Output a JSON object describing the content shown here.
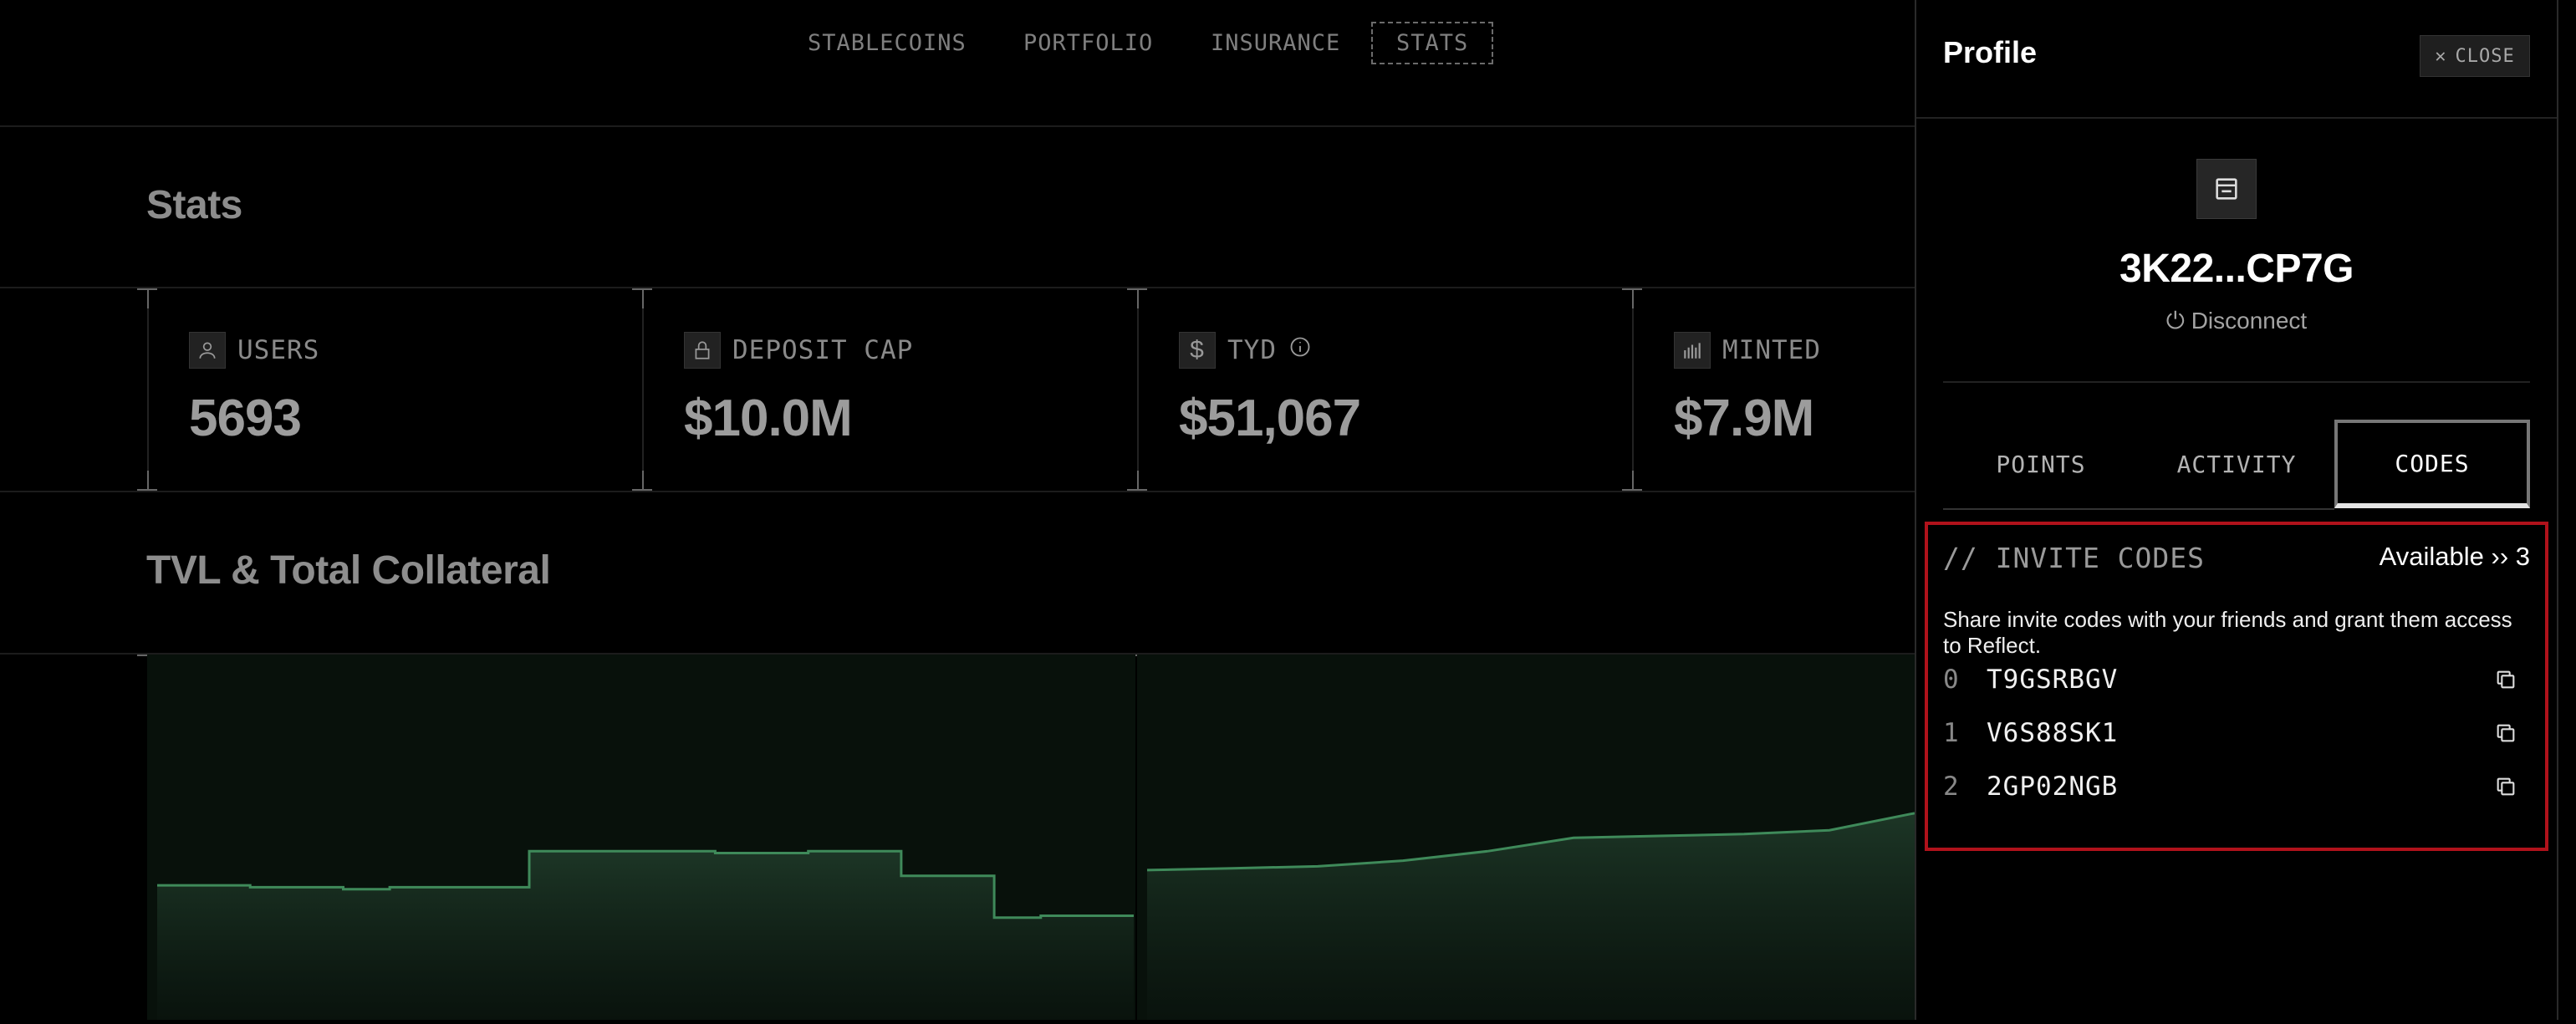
{
  "nav": {
    "items": [
      "STABLECOINS",
      "PORTFOLIO",
      "INSURANCE",
      "STATS"
    ],
    "active": "STATS"
  },
  "stats": {
    "title": "Stats",
    "cards": [
      {
        "label": "USERS",
        "value": "5693",
        "icon": "user-icon"
      },
      {
        "label": "DEPOSIT CAP",
        "value": "$10.0M",
        "icon": "lock-icon"
      },
      {
        "label": "TYD",
        "value": "$51,067",
        "icon": "dollar-icon"
      },
      {
        "label": "MINTED",
        "value": "$7.9M",
        "icon": "bars-icon"
      }
    ]
  },
  "chart_section": {
    "title": "TVL & Total Collateral"
  },
  "chart_data": {
    "type": "area",
    "color": "#3f8a5a",
    "series": [
      {
        "values": [
          0.62,
          0.62,
          0.61,
          0.61,
          0.6,
          0.61,
          0.61,
          0.61,
          0.8,
          0.8,
          0.8,
          0.8,
          0.79,
          0.79,
          0.8,
          0.8,
          0.67,
          0.67,
          0.45,
          0.46,
          0.46,
          0.46
        ]
      },
      {
        "values": [
          0.7,
          0.71,
          0.72,
          0.75,
          0.8,
          0.87,
          0.88,
          0.89,
          0.91,
          1.0
        ]
      }
    ]
  },
  "panel": {
    "title": "Profile",
    "close_label": "CLOSE",
    "address": "3K22...CP7G",
    "disconnect_label": "Disconnect",
    "tabs": [
      "POINTS",
      "ACTIVITY",
      "CODES"
    ],
    "active_tab": "CODES",
    "invite": {
      "heading": "// INVITE CODES",
      "available_label": "Available ›› 3",
      "description": "Share invite codes with your friends and grant them access to Reflect.",
      "codes": [
        {
          "index": "0",
          "code": "T9GSRBGV"
        },
        {
          "index": "1",
          "code": "V6S88SK1"
        },
        {
          "index": "2",
          "code": "2GP02NGB"
        }
      ]
    },
    "highlight_color": "#b0121b"
  }
}
